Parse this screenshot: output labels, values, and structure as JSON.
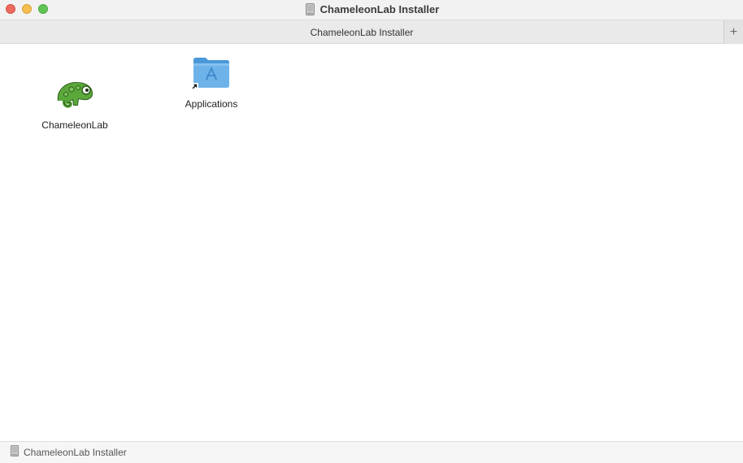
{
  "window": {
    "title": "ChameleonLab Installer"
  },
  "tabbar": {
    "tab_label": "ChameleonLab Installer",
    "add_symbol": "+"
  },
  "content": {
    "items": [
      {
        "label": "ChameleonLab",
        "icon": "chameleon-app-icon"
      },
      {
        "label": "Applications",
        "icon": "applications-folder-alias-icon"
      }
    ]
  },
  "statusbar": {
    "path_label": "ChameleonLab Installer"
  },
  "colors": {
    "close": "#ed6a5e",
    "minimize": "#f5bf4f",
    "maximize": "#61c554",
    "folder": "#6db3ea",
    "chameleon": "#5aa83a"
  }
}
